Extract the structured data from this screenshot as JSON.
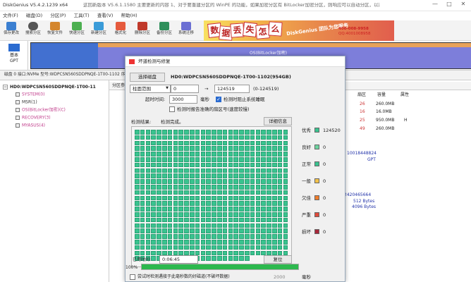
{
  "window": {
    "title": "DiskGenius V5.4.2.1239 x64",
    "notice": "这回新版本 V5.6.1.1580 主要更新的内容 1、对于要重建分区的 WinPE 的功能，如果加密分区有 BitLocker加密分区，则响应可以自动分区，以前的完成后再...",
    "controls": [
      "—",
      "□",
      "✕"
    ]
  },
  "menu": [
    "文件(F)",
    "磁盘(D)",
    "分区(P)",
    "工具(T)",
    "查看(V)",
    "帮助(H)"
  ],
  "toolbar": [
    {
      "label": "保存更改",
      "icon": "save-icon",
      "color": "#3b7fd1"
    },
    {
      "label": "搜索分区",
      "icon": "search-icon",
      "color": "#555555"
    },
    {
      "label": "恢复文件",
      "icon": "recover-icon",
      "color": "#d4862e"
    },
    {
      "label": "快速分区",
      "icon": "quick-partition-icon",
      "color": "#4caf50"
    },
    {
      "label": "新建分区",
      "icon": "new-partition-icon",
      "color": "#3a9bd8"
    },
    {
      "label": "格式化",
      "icon": "format-icon",
      "color": "#e55a3d"
    },
    {
      "label": "删除分区",
      "icon": "delete-icon",
      "color": "#c0392b"
    },
    {
      "label": "备份分区",
      "icon": "backup-icon",
      "color": "#2f8f5b"
    },
    {
      "label": "系统迁移",
      "icon": "migrate-icon",
      "color": "#6b6fd3"
    }
  ],
  "banner": {
    "chars": [
      "数",
      "据",
      "丢",
      "失",
      "怎",
      "么",
      "办"
    ],
    "slogan": "DiskGenius 团队为您服务",
    "phone": "400-008-9958",
    "qq": "QQ:4001008958"
  },
  "diskmap": {
    "box_line1": "基本",
    "box_line2": "GPT",
    "partition_label": "OS(BitLocker加密)"
  },
  "infobar": "磁盘 0  接口:NVMe  型号:WDPCSN560SDDPNQE-1T00-1102  序列号:...  容量:953.9GB(976762MB)  柱面数:124519  磁头数:255  每道扇区数:63  总扇区数:2000409264",
  "tree": [
    {
      "label": "HD0:WDPCSN560SDDPNQE-1T00-11",
      "color": "#222222",
      "level": 0
    },
    {
      "label": "SYSTEM(0)",
      "color": "#c03a8a",
      "level": 1
    },
    {
      "label": "MSR(1)",
      "color": "#333333",
      "level": 1
    },
    {
      "label": "OS(BitLocker加密)(C)",
      "color": "#c03a8a",
      "level": 1
    },
    {
      "label": "RECOVERY(3)",
      "color": "#c03a8a",
      "level": 1
    },
    {
      "label": "MYASUS(4)",
      "color": "#c03a8a",
      "level": 1
    }
  ],
  "right_pane": {
    "tab": "分区参数",
    "headers": [
      "扇区",
      "容量",
      "属性"
    ],
    "rows": [
      [
        "26",
        "260.0MB",
        ""
      ],
      [
        "16",
        "16.0MB",
        ""
      ],
      [
        "25",
        "950.0MB",
        "H"
      ],
      [
        "49",
        "260.0MB",
        ""
      ]
    ],
    "details": [
      "10018448824",
      "GPT",
      "2420465664",
      "512 Bytes",
      "4096 Bytes"
    ]
  },
  "dialog": {
    "title": "坏道检测与修复",
    "select_disk_button": "选择磁盘",
    "disk_name": "HD0:WDPCSN560SDDPNQE-1T00-1102(954GB)",
    "range_label": "柱面范围",
    "range_from": "0",
    "range_to": "124519",
    "range_note": "(0-124519)",
    "timeout_label": "超时时间:",
    "timeout_value": "3000",
    "timeout_unit": "毫秒",
    "check_stop": "检测时阻止系统睡眠",
    "check_report": "检测时报告准确的扇区号(速度较慢)",
    "result_label": "检测结果:",
    "result_status": "检测完成。",
    "detail_button": "详细信息",
    "legend": [
      {
        "name": "优秀",
        "color": "#39c38f",
        "count": "124520"
      },
      {
        "name": "良好",
        "color": "#6cd49f",
        "count": "0"
      },
      {
        "name": "正常",
        "color": "#39c38f",
        "count": "0"
      },
      {
        "name": "一般",
        "color": "#f2c24a",
        "count": "0"
      },
      {
        "name": "欠佳",
        "color": "#f07d2b",
        "count": "0"
      },
      {
        "name": "严重",
        "color": "#e04b3c",
        "count": "0"
      },
      {
        "name": "损坏",
        "color": "#a8283a",
        "count": "0"
      }
    ],
    "elapsed_label": "已用时间:",
    "elapsed_value": "0:06:45",
    "reset_button": "复位",
    "progress_text": "100%",
    "progress_value": 1.0,
    "bottom_check": "尝试时检测遇接于此毫秒数的好磁道(不破坏数据)",
    "bottom_value": "2000",
    "bottom_unit": "毫秒"
  }
}
